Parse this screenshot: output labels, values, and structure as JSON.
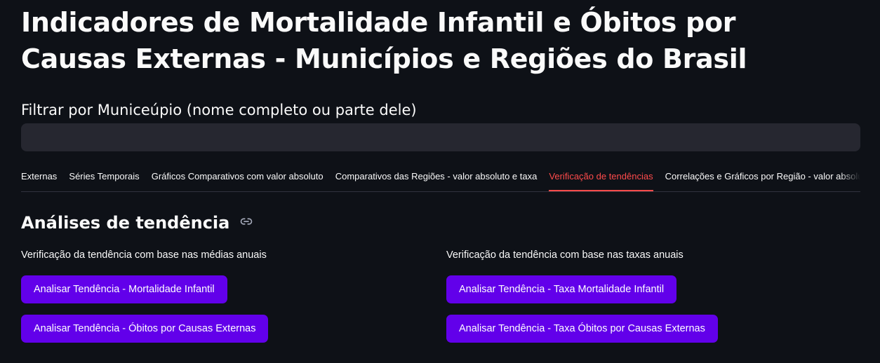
{
  "header": {
    "title": "Indicadores de Mortalidade Infantil e Óbitos por Causas Externas - Municípios e Regiões do Brasil"
  },
  "filter": {
    "label": "Filtrar por Municeúpio (nome completo ou parte dele)",
    "value": "",
    "placeholder": ""
  },
  "tabs": [
    {
      "label": "Externas",
      "active": false
    },
    {
      "label": "Séries Temporais",
      "active": false
    },
    {
      "label": "Gráficos Comparativos com valor absoluto",
      "active": false
    },
    {
      "label": "Comparativos das Regiões - valor absoluto e taxa",
      "active": false
    },
    {
      "label": "Verificação de tendências",
      "active": true
    },
    {
      "label": "Correlações e Gráficos por Região - valor absoluto",
      "active": false
    }
  ],
  "section": {
    "heading": "Análises de tendência",
    "heading_icon": "link-icon"
  },
  "left_column": {
    "description": "Verificação da tendência com base nas médias anuais",
    "buttons": [
      {
        "label": "Analisar Tendência - Mortalidade Infantil"
      },
      {
        "label": "Analisar Tendência - Óbitos por Causas Externas"
      }
    ]
  },
  "right_column": {
    "description": "Verificação da tendência com base nas taxas anuais",
    "buttons": [
      {
        "label": "Analisar Tendência - Taxa Mortalidade Infantil"
      },
      {
        "label": "Analisar Tendência - Taxa Óbitos por Causas Externas"
      }
    ]
  },
  "colors": {
    "background": "#0e1117",
    "input_background": "#262730",
    "accent": "#ff4b4b",
    "button": "#6200ea",
    "text": "#fafafa"
  }
}
